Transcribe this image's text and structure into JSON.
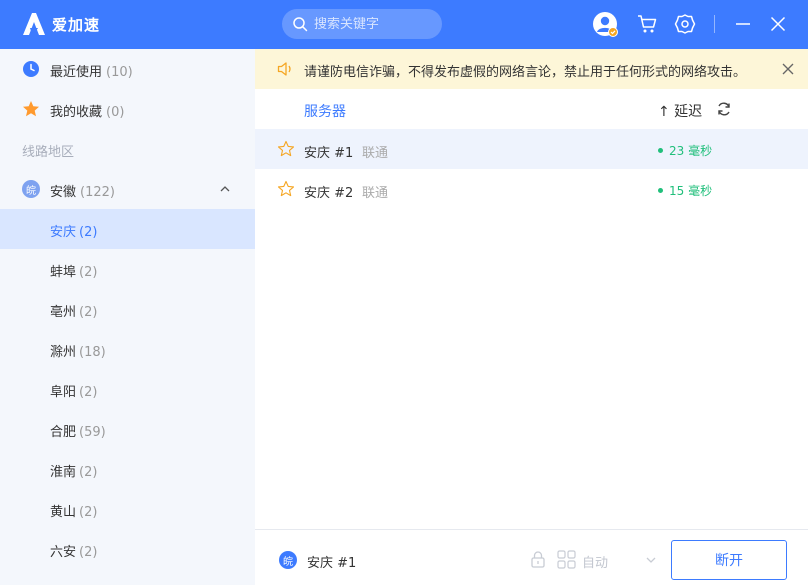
{
  "app": {
    "name": "爱加速"
  },
  "search": {
    "placeholder": "搜索关键字"
  },
  "sidebar": {
    "recent": {
      "label": "最近使用",
      "count": "(10)"
    },
    "favorites": {
      "label": "我的收藏",
      "count": "(0)"
    },
    "section_title": "线路地区",
    "province": {
      "badge": "皖",
      "label": "安徽",
      "count": "(122)"
    },
    "cities": [
      {
        "label": "安庆",
        "count": "(2)"
      },
      {
        "label": "蚌埠",
        "count": "(2)"
      },
      {
        "label": "亳州",
        "count": "(2)"
      },
      {
        "label": "滁州",
        "count": "(18)"
      },
      {
        "label": "阜阳",
        "count": "(2)"
      },
      {
        "label": "合肥",
        "count": "(59)"
      },
      {
        "label": "淮南",
        "count": "(2)"
      },
      {
        "label": "黄山",
        "count": "(2)"
      },
      {
        "label": "六安",
        "count": "(2)"
      }
    ]
  },
  "notice": {
    "text": "请谨防电信诈骗，不得发布虚假的网络言论，禁止用于任何形式的网络攻击。"
  },
  "table": {
    "col_server": "服务器",
    "col_latency": "↑ 延迟",
    "rows": [
      {
        "name": "安庆 #1",
        "isp": "联通",
        "latency": "23 毫秒"
      },
      {
        "name": "安庆 #2",
        "isp": "联通",
        "latency": "15 毫秒"
      }
    ]
  },
  "footer": {
    "badge": "皖",
    "current": "安庆 #1",
    "mode": "自动",
    "disconnect_label": "断开"
  },
  "colors": {
    "brand": "#3d7bff",
    "latency_good": "#20bf7b",
    "notice_bg": "#fdf6d8"
  }
}
